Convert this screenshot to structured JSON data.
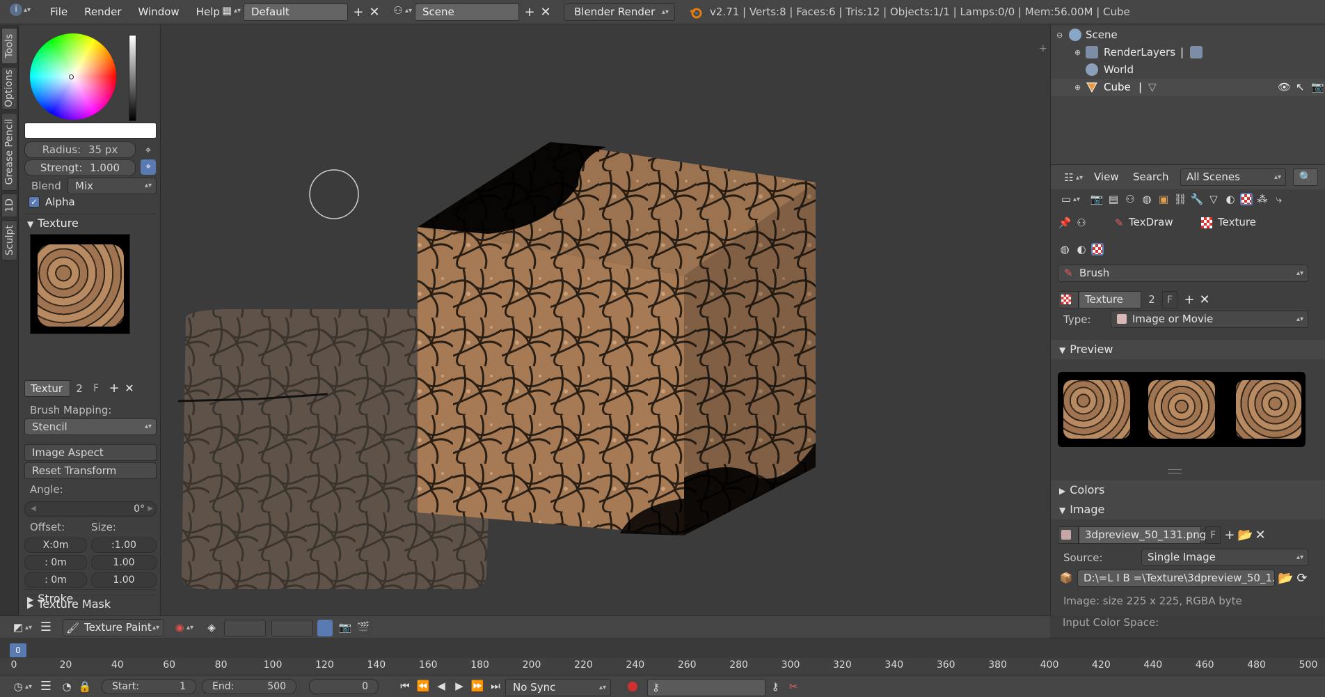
{
  "topbar": {
    "menus": [
      "File",
      "Render",
      "Window",
      "Help"
    ],
    "layout": "Default",
    "scene": "Scene",
    "engine": "Blender Render",
    "stats": "v2.71 | Verts:8 | Faces:6 | Tris:12 | Objects:1/1 | Lamps:0/0 | Mem:56.00M | Cube"
  },
  "vtabs": [
    "Tools",
    "Options",
    "Grease Pencil",
    "1D",
    "Sculpt"
  ],
  "toolpanel": {
    "radius_label": "Radius:",
    "radius_value": "35 px",
    "strength_label": "Strengt:",
    "strength_value": "1.000",
    "blend_label": "Blend",
    "blend_value": "Mix",
    "alpha_label": "Alpha",
    "texture_header": "Texture",
    "texture_name": "Textur",
    "texture_users": "2",
    "texture_fake": "F",
    "brush_mapping_label": "Brush Mapping:",
    "brush_mapping_value": "Stencil",
    "image_aspect": "Image Aspect",
    "reset_transform": "Reset Transform",
    "angle_label": "Angle:",
    "angle_value": "0°",
    "offset_label": "Offset:",
    "size_label": "Size:",
    "offset_x": "X:0m",
    "offset_y": ":  0m",
    "offset_z": ":  0m",
    "size_x": ":1.00",
    "size_y": "1.00",
    "size_z": "1.00",
    "texture_mask": "Texture Mask",
    "stroke": "Stroke"
  },
  "viewport_header": {
    "mode": "Texture Paint"
  },
  "outliner": {
    "rows": [
      {
        "label": "Scene"
      },
      {
        "label": "RenderLayers"
      },
      {
        "label": "World"
      },
      {
        "label": "Cube"
      }
    ],
    "header": {
      "view": "View",
      "search": "Search",
      "filter": "All Scenes"
    }
  },
  "properties": {
    "tex_draw": "TexDraw",
    "texture_tab": "Texture",
    "brush": "Brush",
    "texture_name": "Texture",
    "texture_users": "2",
    "texture_fake": "F",
    "type_label": "Type:",
    "type_value": "Image or Movie",
    "preview": "Preview",
    "colors": "Colors",
    "image": "Image",
    "image_name": "3dpreview_50_131.png",
    "image_fake": "F",
    "source_label": "Source:",
    "source_value": "Single Image",
    "filepath": "D:\\=L I B =\\Texture\\3dpreview_50_1...",
    "image_info": "Image: size 225 x 225, RGBA byte",
    "color_space_label": "Input Color Space:"
  },
  "timeline": {
    "current_frame_marker": "0",
    "ticks": [
      "0",
      "20",
      "40",
      "60",
      "80",
      "100",
      "120",
      "140",
      "160",
      "180",
      "200",
      "220",
      "240",
      "260",
      "280",
      "300",
      "320",
      "340",
      "360",
      "380",
      "400",
      "420",
      "440",
      "460",
      "480",
      "500"
    ],
    "start_label": "Start:",
    "start_value": "1",
    "end_label": "End:",
    "end_value": "500",
    "current_value": "0",
    "sync": "No Sync"
  }
}
